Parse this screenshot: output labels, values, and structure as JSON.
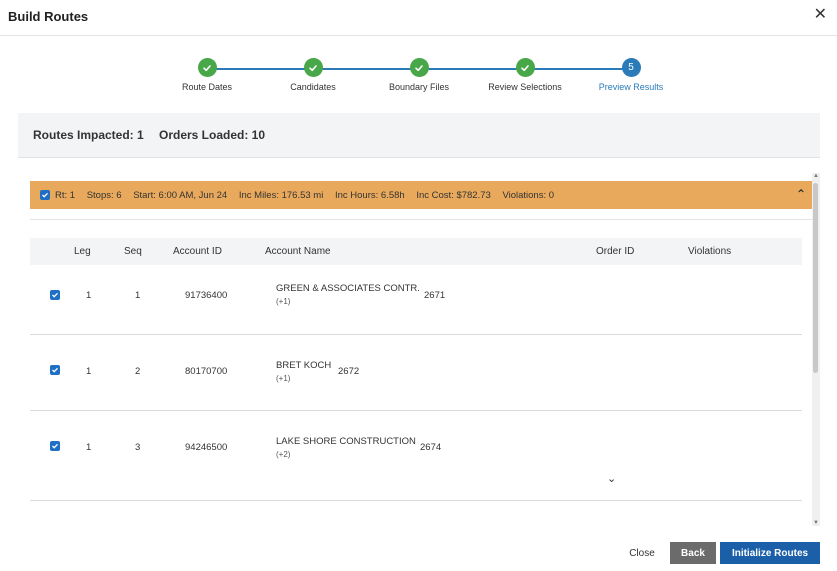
{
  "dialog": {
    "title": "Build Routes",
    "close_icon": "close-icon"
  },
  "stepper": {
    "steps": [
      {
        "label": "Route Dates",
        "state": "done"
      },
      {
        "label": "Candidates",
        "state": "done"
      },
      {
        "label": "Boundary Files",
        "state": "done"
      },
      {
        "label": "Review Selections",
        "state": "done"
      },
      {
        "label": "Preview Results",
        "state": "active",
        "number": "5"
      }
    ]
  },
  "summary": {
    "routes_impacted": "Routes Impacted: 1",
    "orders_loaded": "Orders Loaded: 10"
  },
  "route": {
    "rt": "Rt: 1",
    "stops": "Stops: 6",
    "start": "Start: 6:00 AM, Jun 24",
    "inc_miles": "Inc Miles: 176.53 mi",
    "inc_hours": "Inc Hours: 6.58h",
    "inc_cost": "Inc Cost: $782.73",
    "violations": "Violations: 0"
  },
  "table": {
    "headers": {
      "leg": "Leg",
      "seq": "Seq",
      "account_id": "Account ID",
      "account_name": "Account Name",
      "order_id": "Order ID",
      "violations": "Violations"
    },
    "rows": [
      {
        "leg": "1",
        "seq": "1",
        "account_id": "91736400",
        "account_name": "GREEN & ASSOCIATES CONTR.",
        "extra": "(+1)",
        "order_id": "2671"
      },
      {
        "leg": "1",
        "seq": "2",
        "account_id": "80170700",
        "account_name": "BRET KOCH",
        "extra": "(+1)",
        "order_id": "2672"
      },
      {
        "leg": "1",
        "seq": "3",
        "account_id": "94246500",
        "account_name": "LAKE SHORE CONSTRUCTION",
        "extra": "(+2)",
        "order_id": "2674"
      }
    ]
  },
  "footer": {
    "close": "Close",
    "back": "Back",
    "initialize": "Initialize Routes"
  },
  "colors": {
    "done": "#48a748",
    "active": "#2b7bb9",
    "route_bar": "#e8a95c",
    "primary": "#1a5fa8"
  }
}
